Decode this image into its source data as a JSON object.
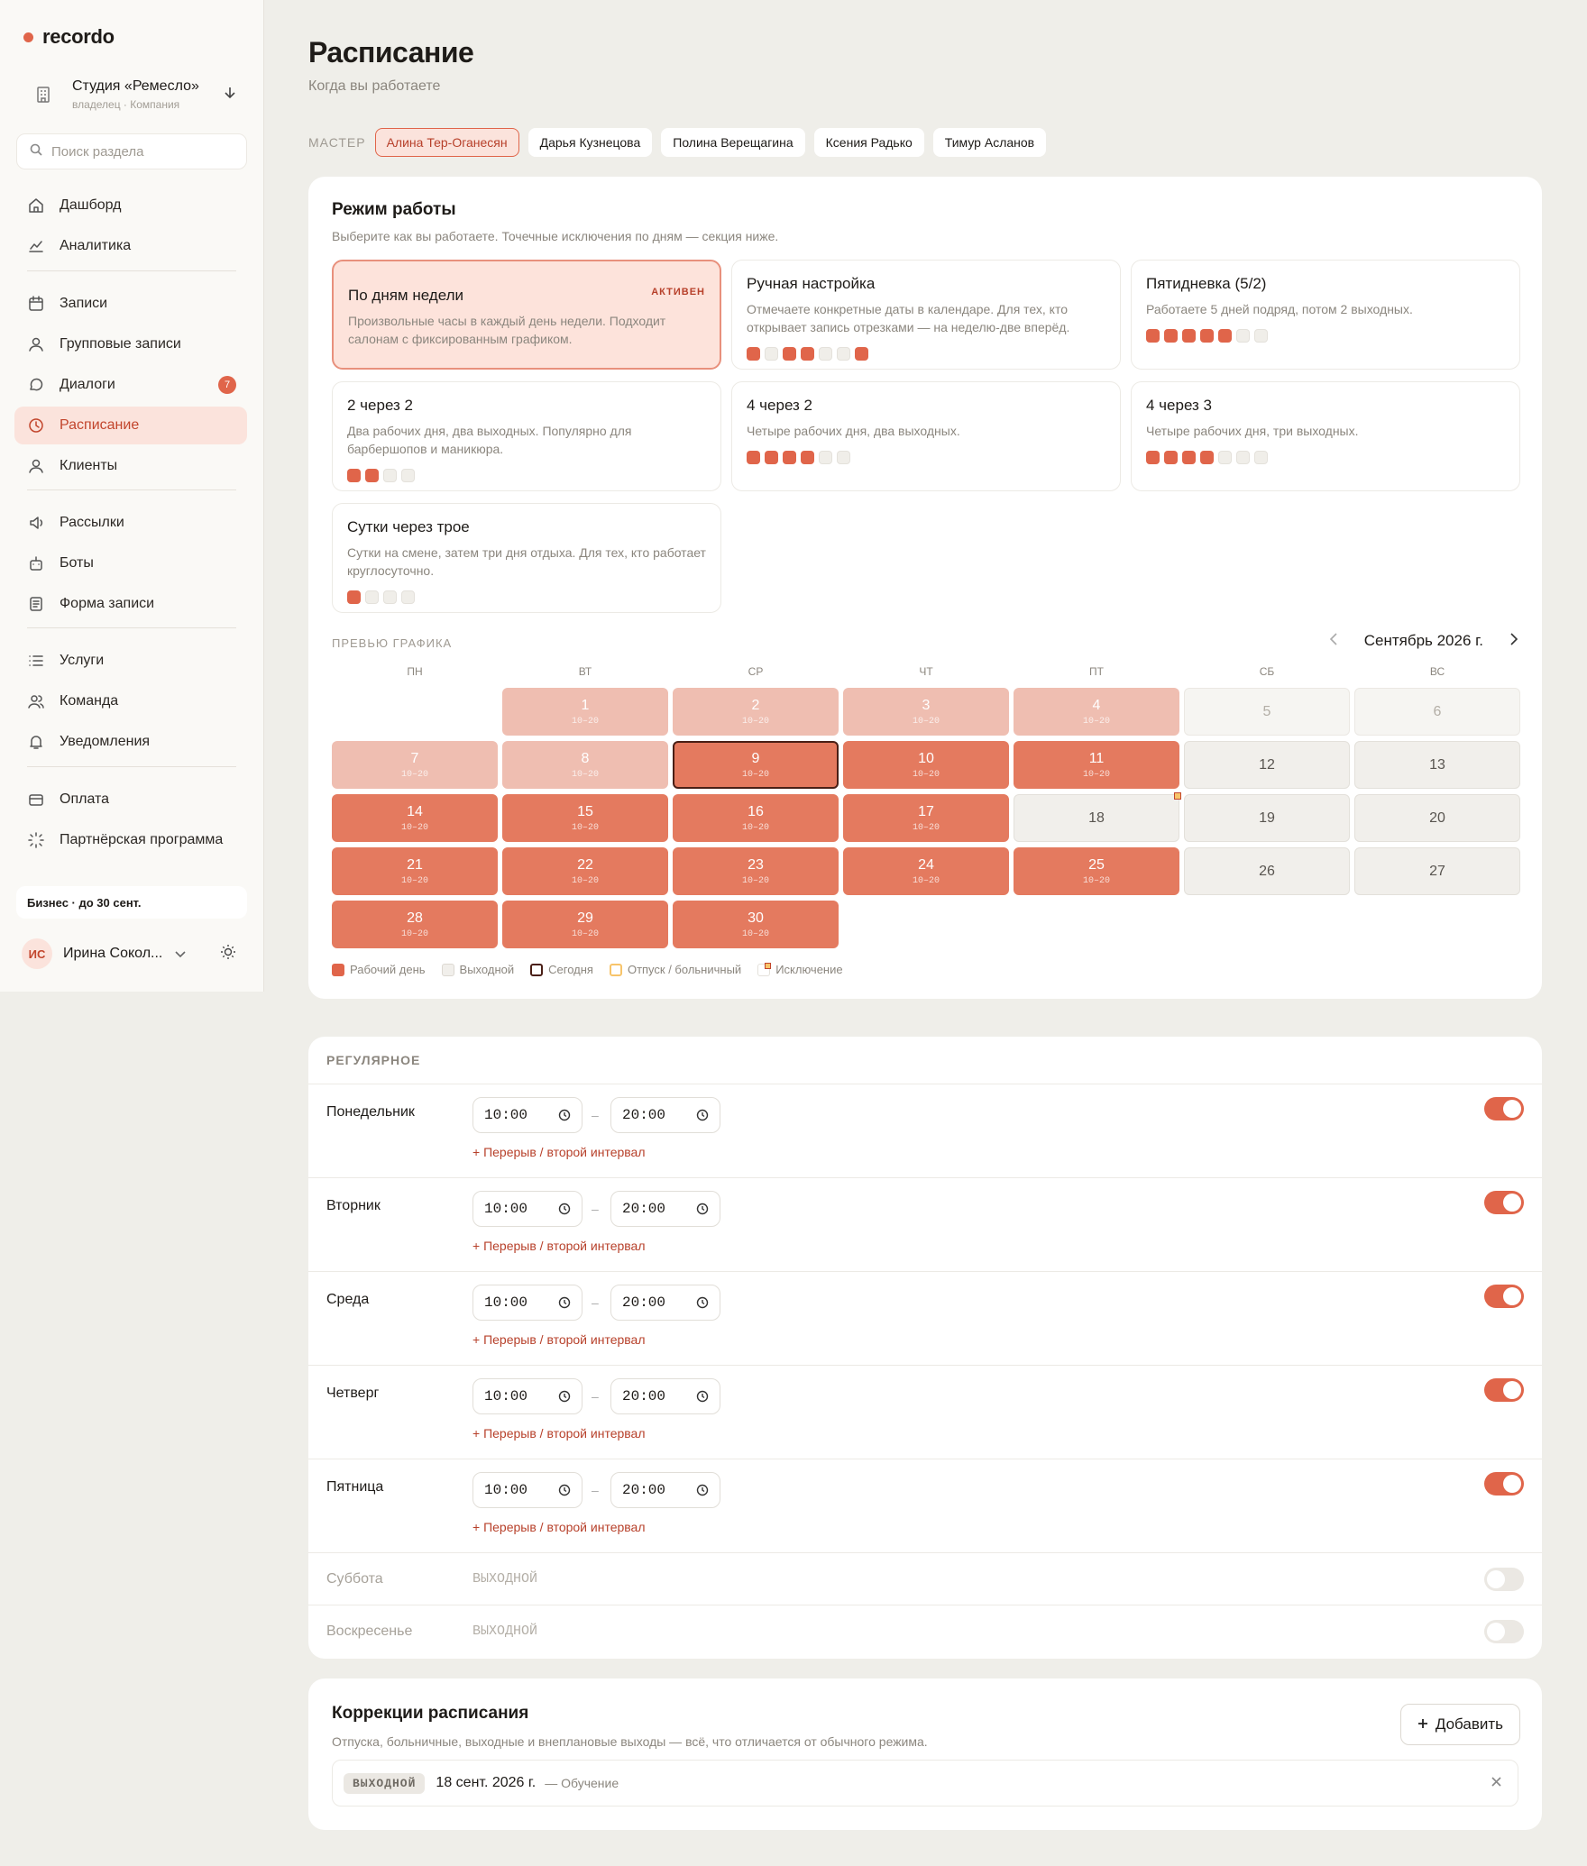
{
  "sidebar": {
    "brand": "recordo",
    "company_name": "Студия «Ремесло»",
    "company_sub": "владелец · Компания",
    "search_placeholder": "Поиск раздела",
    "items": [
      {
        "label": "Дашборд"
      },
      {
        "label": "Аналитика"
      },
      {
        "label": "Записи"
      },
      {
        "label": "Групповые записи"
      },
      {
        "label": "Диалоги",
        "badge": "7"
      },
      {
        "label": "Расписание",
        "active": true
      },
      {
        "label": "Клиенты"
      },
      {
        "label": "Рассылки"
      },
      {
        "label": "Боты"
      },
      {
        "label": "Форма записи"
      },
      {
        "label": "Услуги"
      },
      {
        "label": "Команда"
      },
      {
        "label": "Уведомления"
      },
      {
        "label": "Оплата"
      },
      {
        "label": "Партнёрская программа"
      }
    ],
    "plan": "Бизнес · до 30 сент.",
    "user_initials": "ИС",
    "user_name": "Ирина Сокол..."
  },
  "page": {
    "title": "Расписание",
    "subtitle": "Когда вы работаете"
  },
  "masters": {
    "label": "МАСТЕР",
    "list": [
      "Алина Тер-Оганесян",
      "Дарья Кузнецова",
      "Полина Верещагина",
      "Ксения Радько",
      "Тимур Асланов"
    ],
    "selected": 0
  },
  "modes": {
    "title": "Режим работы",
    "subtitle": "Выберите как вы работаете. Точечные исключения по дням — секция ниже.",
    "active_badge": "АКТИВЕН",
    "items": [
      {
        "title": "По дням недели",
        "desc": "Произвольные часы в каждый день недели. Подходит салонам с фиксированным графиком.",
        "active": true,
        "pattern": []
      },
      {
        "title": "Ручная настройка",
        "desc": "Отмечаете конкретные даты в календаре. Для тех, кто открывает запись отрезками — на неделю-две вперёд.",
        "pattern": [
          1,
          0,
          1,
          1,
          0,
          0,
          1
        ]
      },
      {
        "title": "Пятидневка (5/2)",
        "desc": "Работаете 5 дней подряд, потом 2 выходных.",
        "pattern": [
          1,
          1,
          1,
          1,
          1,
          0,
          0
        ]
      },
      {
        "title": "2 через 2",
        "desc": "Два рабочих дня, два выходных. Популярно для барбершопов и маникюра.",
        "pattern": [
          1,
          1,
          0,
          0
        ]
      },
      {
        "title": "4 через 2",
        "desc": "Четыре рабочих дня, два выходных.",
        "pattern": [
          1,
          1,
          1,
          1,
          0,
          0
        ]
      },
      {
        "title": "4 через 3",
        "desc": "Четыре рабочих дня, три выходных.",
        "pattern": [
          1,
          1,
          1,
          1,
          0,
          0,
          0
        ]
      },
      {
        "title": "Сутки через трое",
        "desc": "Сутки на смене, затем три дня отдыха. Для тех, кто работает круглосуточно.",
        "pattern": [
          1,
          0,
          0,
          0
        ]
      }
    ]
  },
  "preview": {
    "label": "ПРЕВЬЮ ГРАФИКА",
    "month": "Сентябрь 2026 г.",
    "weekdays": [
      "ПН",
      "ВТ",
      "СР",
      "ЧТ",
      "ПТ",
      "СБ",
      "ВС"
    ],
    "first_weekday_index": 1,
    "days_in_month": 30,
    "today": 9,
    "hours_label": "10–20",
    "work_days": [
      1,
      2,
      3,
      4,
      7,
      8,
      9,
      10,
      11,
      14,
      15,
      16,
      17,
      21,
      22,
      23,
      24,
      25,
      28,
      29,
      30
    ],
    "past_days": [
      1,
      2,
      3,
      4,
      5,
      6,
      7,
      8
    ],
    "exception_days": [
      18
    ],
    "legend": [
      "Рабочий день",
      "Выходной",
      "Сегодня",
      "Отпуск / больничный",
      "Исключение"
    ],
    "legend_colors": [
      "#e0654a",
      "#f1efeb",
      "#4a1f16",
      "#f7c46a",
      "#f7c46a"
    ]
  },
  "regular": {
    "label": "РЕГУЛЯРНОЕ",
    "add_break_label": "+ Перерыв / второй интервал",
    "weekend_label": "ВЫХОДНОЙ",
    "days": [
      {
        "name": "Понедельник",
        "on": true,
        "from": "10:00",
        "to": "20:00"
      },
      {
        "name": "Вторник",
        "on": true,
        "from": "10:00",
        "to": "20:00"
      },
      {
        "name": "Среда",
        "on": true,
        "from": "10:00",
        "to": "20:00"
      },
      {
        "name": "Четверг",
        "on": true,
        "from": "10:00",
        "to": "20:00"
      },
      {
        "name": "Пятница",
        "on": true,
        "from": "10:00",
        "to": "20:00"
      },
      {
        "name": "Суббота",
        "on": false
      },
      {
        "name": "Воскресенье",
        "on": false
      }
    ]
  },
  "corrections": {
    "title": "Коррекции расписания",
    "subtitle": "Отпуска, больничные, выходные и внеплановые выходы — всё, что отличается от обычного режима.",
    "add_label": "Добавить",
    "items": [
      {
        "tag": "ВЫХОДНОЙ",
        "date": "18 сент. 2026 г.",
        "note": "— Обучение"
      }
    ]
  }
}
